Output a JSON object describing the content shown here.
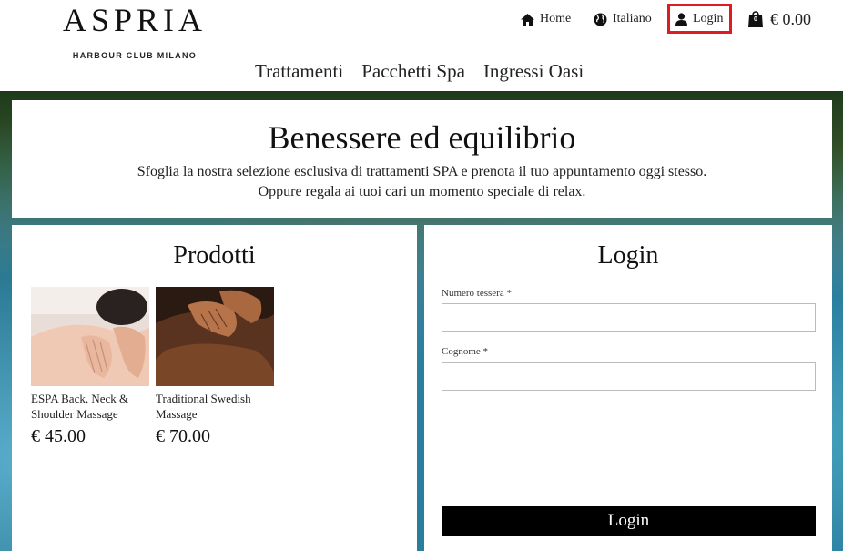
{
  "brand": {
    "name": "ASPRIA",
    "subtitle": "HARBOUR CLUB MILANO"
  },
  "topnav": {
    "home": "Home",
    "language": "Italiano",
    "login": "Login",
    "cart_count": "0",
    "cart_total": "€ 0.00"
  },
  "mainnav": [
    "Trattamenti",
    "Pacchetti Spa",
    "Ingressi Oasi"
  ],
  "hero": {
    "title": "Benessere ed equilibrio",
    "line1": "Sfoglia la nostra selezione esclusiva di trattamenti SPA e prenota il tuo appuntamento oggi stesso.",
    "line2": "Oppure regala ai tuoi cari un momento speciale di relax."
  },
  "products": {
    "heading": "Prodotti",
    "items": [
      {
        "name": "ESPA Back, Neck & Shoulder Massage",
        "price": "€ 45.00"
      },
      {
        "name": "Traditional Swedish Massage",
        "price": "€ 70.00"
      }
    ]
  },
  "login": {
    "heading": "Login",
    "card_label": "Numero tessera *",
    "card_value": "",
    "surname_label": "Cognome *",
    "surname_value": "",
    "button": "Login"
  },
  "colors": {
    "highlight": "#e01b22",
    "button_bg": "#000000"
  },
  "icons": [
    "home-icon",
    "globe-icon",
    "user-icon",
    "shopping-bag-icon"
  ]
}
